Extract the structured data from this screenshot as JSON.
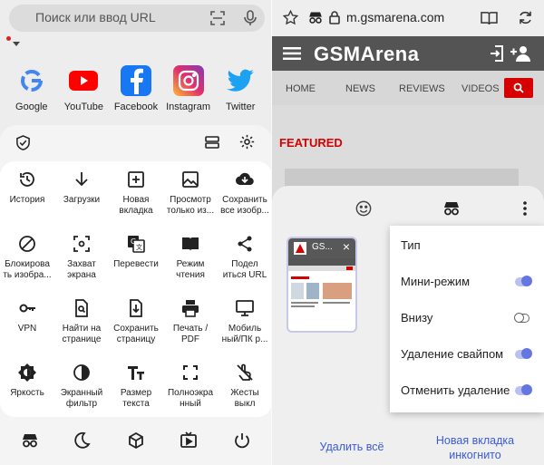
{
  "left": {
    "search": {
      "placeholder": "Поиск или ввод URL"
    },
    "shortcuts": [
      {
        "label": "Google",
        "icon": "google-icon"
      },
      {
        "label": "YouTube",
        "icon": "youtube-icon"
      },
      {
        "label": "Facebook",
        "icon": "facebook-icon"
      },
      {
        "label": "Instagram",
        "icon": "instagram-icon"
      },
      {
        "label": "Twitter",
        "icon": "twitter-icon"
      }
    ],
    "menu": [
      {
        "label": "История",
        "icon": "history-icon"
      },
      {
        "label": "Загрузки",
        "icon": "download-icon"
      },
      {
        "label": "Новая\nвкладка",
        "icon": "new-tab-icon"
      },
      {
        "label": "Просмотр\nтолько из...",
        "icon": "image-icon"
      },
      {
        "label": "Сохранить\nвсе изобр...",
        "icon": "cloud-download-icon"
      },
      {
        "label": "Блокирова\nть изобра...",
        "icon": "block-icon"
      },
      {
        "label": "Захват\nэкрана",
        "icon": "screenshot-icon"
      },
      {
        "label": "Перевести",
        "icon": "translate-icon"
      },
      {
        "label": "Режим\nчтения",
        "icon": "reading-icon"
      },
      {
        "label": "Подел\nиться URL",
        "icon": "share-icon"
      },
      {
        "label": "VPN",
        "icon": "vpn-key-icon"
      },
      {
        "label": "Найти на\nстранице",
        "icon": "find-in-page-icon"
      },
      {
        "label": "Сохранить\nстраницу",
        "icon": "save-page-icon"
      },
      {
        "label": "Печать /\nPDF",
        "icon": "print-icon"
      },
      {
        "label": "Мобиль\nный/ПК р...",
        "icon": "desktop-icon"
      },
      {
        "label": "Яркость",
        "icon": "brightness-icon"
      },
      {
        "label": "Экранный\nфильтр",
        "icon": "contrast-icon"
      },
      {
        "label": "Размер\nтекста",
        "icon": "text-size-icon"
      },
      {
        "label": "Полноэкра\nнный",
        "icon": "fullscreen-icon"
      },
      {
        "label": "Жесты\nвыкл",
        "icon": "gestures-off-icon"
      }
    ]
  },
  "right": {
    "url": "m.gsmarena.com",
    "site_logo": "GSMArena",
    "nav": [
      "HOME",
      "NEWS",
      "REVIEWS",
      "VIDEOS"
    ],
    "featured": "FEATURED",
    "tab": {
      "title": "GS..."
    },
    "dropdown": [
      {
        "label": "Тип",
        "toggle": null
      },
      {
        "label": "Мини-режим",
        "toggle": true
      },
      {
        "label": "Внизу",
        "toggle": false
      },
      {
        "label": "Удаление свайпом",
        "toggle": true
      },
      {
        "label": "Отменить удаление",
        "toggle": true
      }
    ],
    "close_all": "Удалить всё",
    "new_incognito": "Новая вкладка\nинкогнито"
  },
  "colors": {
    "accent": "#3a5bd8",
    "gsm_red": "#d50000",
    "toggle_on": "#6476e0"
  }
}
